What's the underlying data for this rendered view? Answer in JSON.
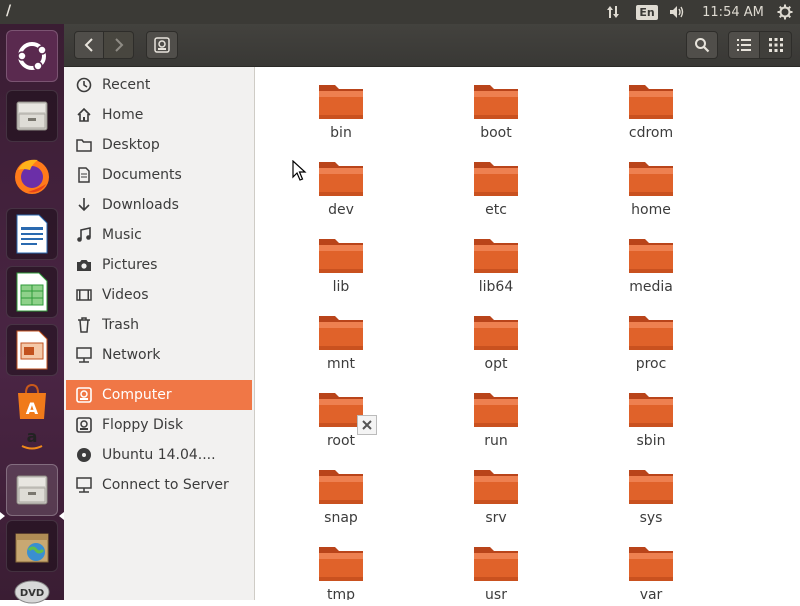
{
  "topbar": {
    "title": "/",
    "keyboard_layout": "En",
    "clock": "11:54 AM",
    "icons": [
      "network-updown-icon",
      "volume-icon",
      "settings-gear-icon"
    ]
  },
  "launcher": {
    "items": [
      {
        "name": "ubuntu-dash-icon"
      },
      {
        "name": "files-icon"
      },
      {
        "name": "firefox-icon"
      },
      {
        "name": "libreoffice-writer-icon"
      },
      {
        "name": "libreoffice-calc-icon"
      },
      {
        "name": "libreoffice-impress-icon"
      },
      {
        "name": "software-center-icon"
      },
      {
        "name": "amazon-icon"
      },
      {
        "name": "files-running-icon"
      },
      {
        "name": "archive-manager-icon"
      },
      {
        "name": "dvd-icon",
        "label": "DVD"
      }
    ]
  },
  "header": {
    "icons": [
      "back-arrow-icon",
      "forward-arrow-icon",
      "computer-path-icon",
      "search-icon",
      "list-view-icon",
      "grid-view-icon"
    ]
  },
  "sidebar": {
    "items": [
      {
        "label": "Recent",
        "icon": "clock-icon"
      },
      {
        "label": "Home",
        "icon": "home-icon"
      },
      {
        "label": "Desktop",
        "icon": "folder-icon"
      },
      {
        "label": "Documents",
        "icon": "document-icon"
      },
      {
        "label": "Downloads",
        "icon": "download-icon"
      },
      {
        "label": "Music",
        "icon": "music-icon"
      },
      {
        "label": "Pictures",
        "icon": "camera-icon"
      },
      {
        "label": "Videos",
        "icon": "video-icon"
      },
      {
        "label": "Trash",
        "icon": "trash-icon"
      },
      {
        "label": "Network",
        "icon": "network-icon"
      },
      {
        "label": "Computer",
        "icon": "computer-icon",
        "active": true
      },
      {
        "label": "Floppy Disk",
        "icon": "floppy-icon"
      },
      {
        "label": "Ubuntu 14.04....",
        "icon": "disc-icon"
      },
      {
        "label": "Connect to Server",
        "icon": "server-icon"
      }
    ]
  },
  "folders": [
    {
      "name": "bin"
    },
    {
      "name": "boot"
    },
    {
      "name": "cdrom"
    },
    {
      "name": "dev"
    },
    {
      "name": "etc"
    },
    {
      "name": "home"
    },
    {
      "name": "lib"
    },
    {
      "name": "lib64"
    },
    {
      "name": "media"
    },
    {
      "name": "mnt"
    },
    {
      "name": "opt"
    },
    {
      "name": "proc"
    },
    {
      "name": "root",
      "locked": true
    },
    {
      "name": "run"
    },
    {
      "name": "sbin"
    },
    {
      "name": "snap"
    },
    {
      "name": "srv"
    },
    {
      "name": "sys"
    },
    {
      "name": "tmp"
    },
    {
      "name": "usr"
    },
    {
      "name": "var"
    }
  ],
  "colors": {
    "accent": "#f07746",
    "folder": "#e0622a",
    "panel": "#3b3a36",
    "launcher": "#4a2544"
  }
}
